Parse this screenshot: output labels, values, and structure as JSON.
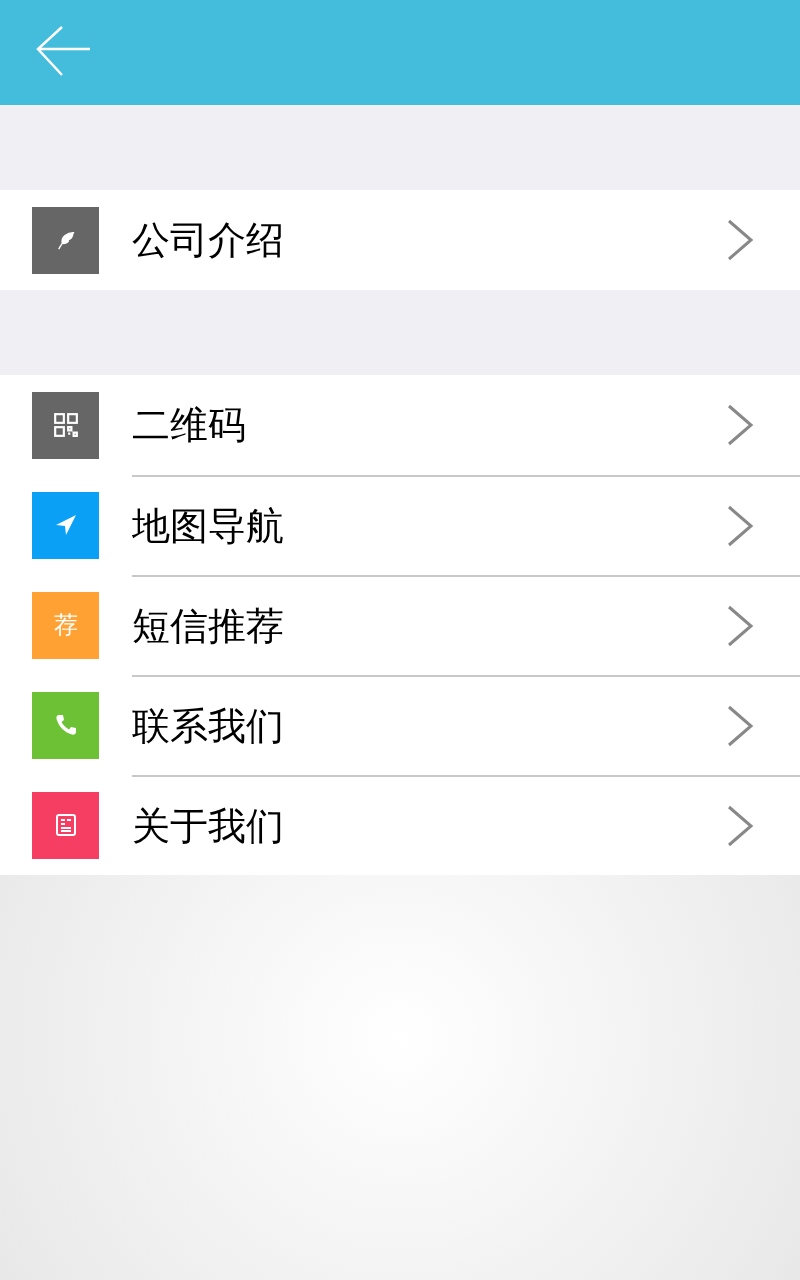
{
  "groups": [
    {
      "items": [
        {
          "label": "公司介绍",
          "kind": "feather",
          "color": "#666666"
        }
      ]
    },
    {
      "items": [
        {
          "label": "二维码",
          "kind": "qr",
          "color": "#666666"
        },
        {
          "label": "地图导航",
          "kind": "navigate",
          "color": "#0aa0f5"
        },
        {
          "label": "短信推荐",
          "kind": "text",
          "icon_text": "荐",
          "color": "#ffa133"
        },
        {
          "label": "联系我们",
          "kind": "phone",
          "color": "#6cc234"
        },
        {
          "label": "关于我们",
          "kind": "document",
          "color": "#f63e62"
        }
      ]
    }
  ]
}
